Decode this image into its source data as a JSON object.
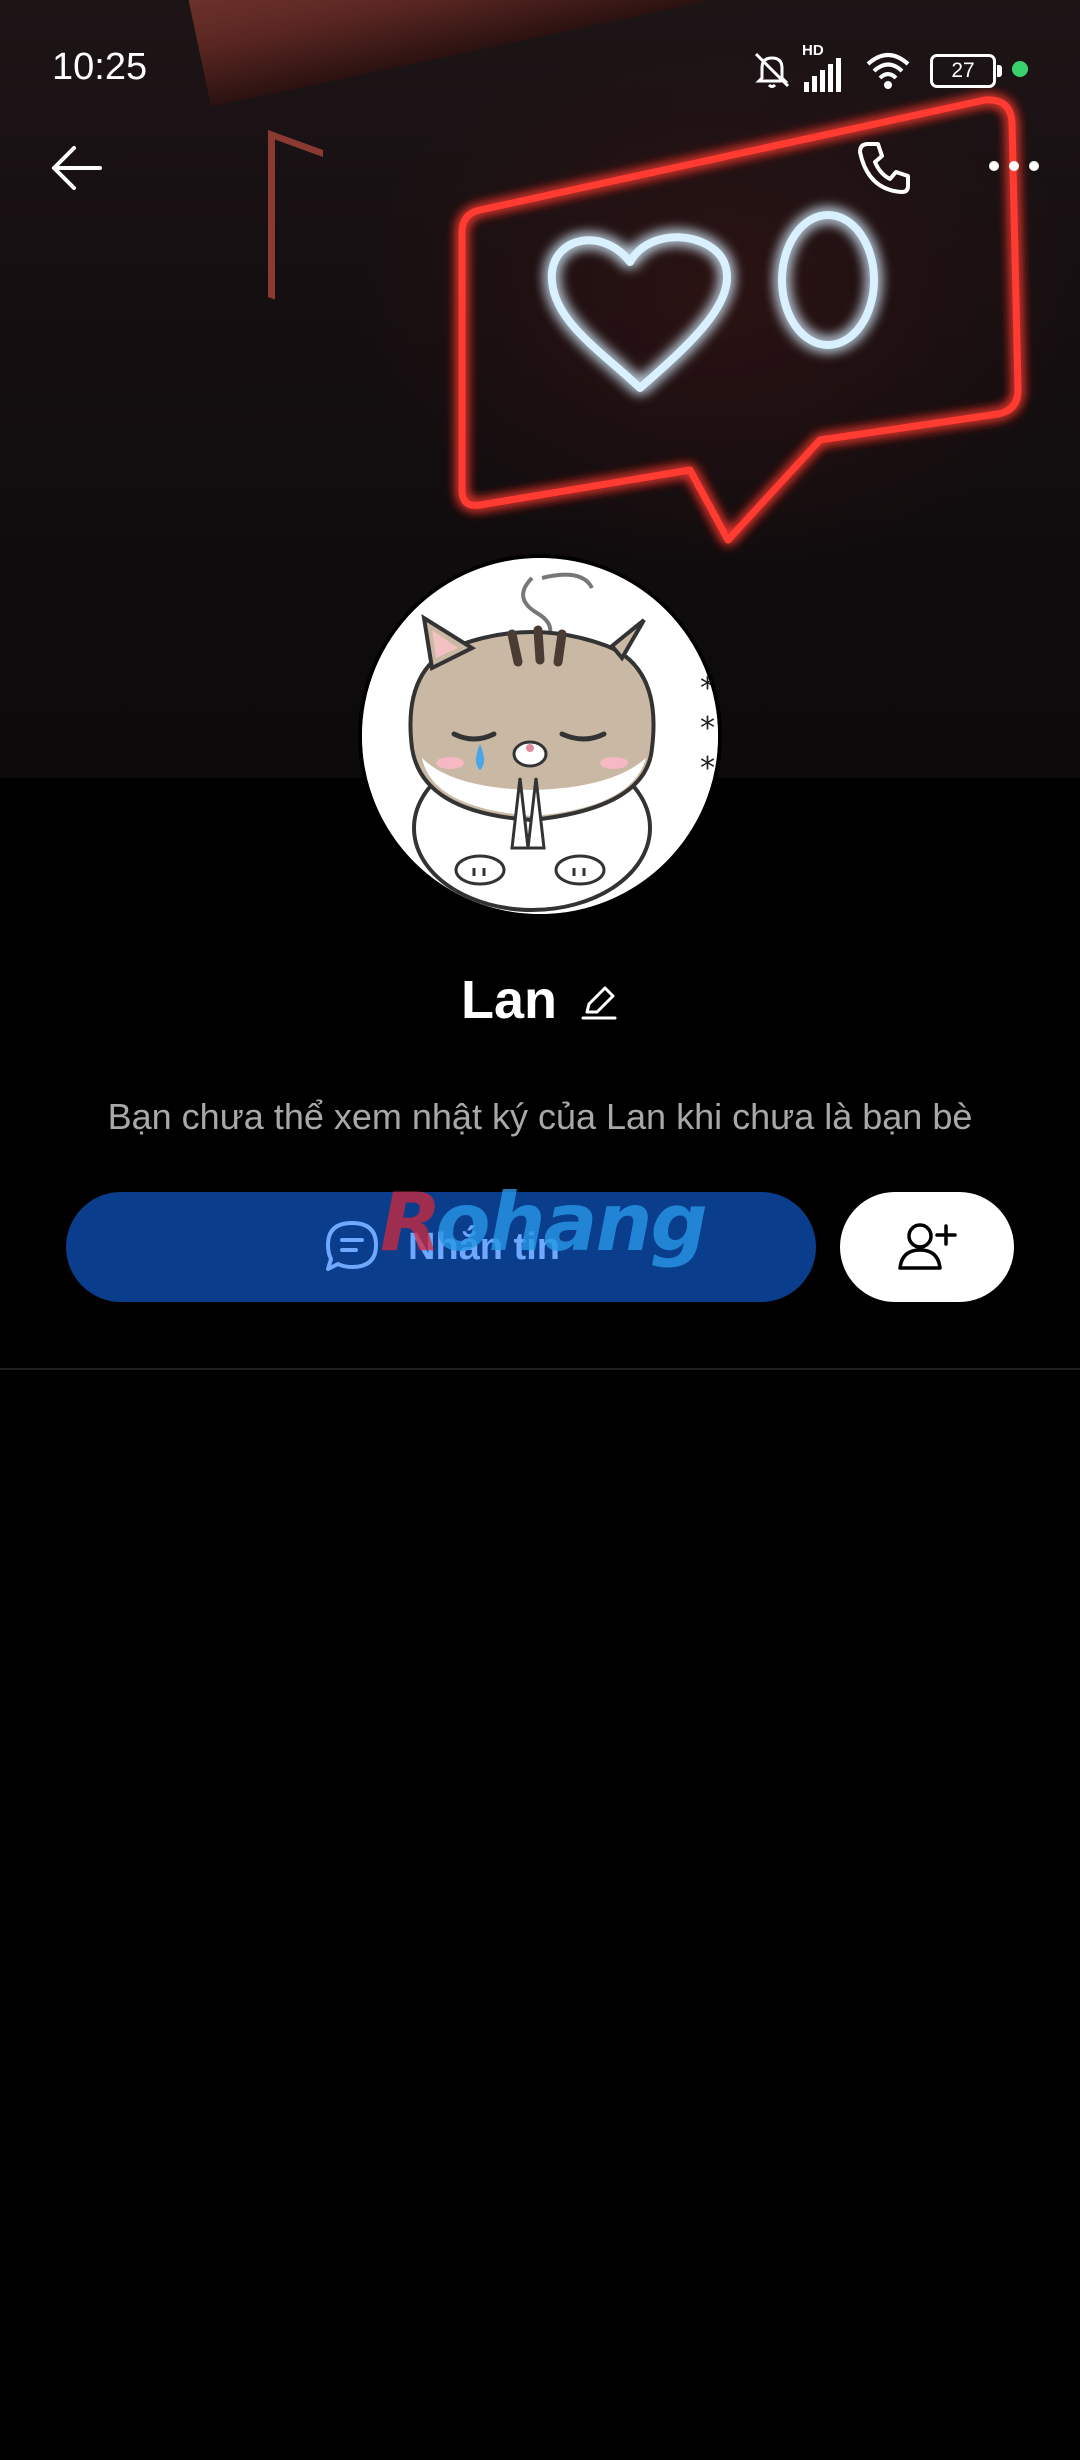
{
  "status_bar": {
    "time": "10:25",
    "network_badge": "HD",
    "battery_level": "27",
    "icons": [
      "mute-notifications-icon",
      "cellular-signal-icon",
      "wifi-icon",
      "battery-icon",
      "active-dot-icon"
    ]
  },
  "header": {
    "icons": [
      "back-arrow-icon",
      "phone-icon",
      "more-icon"
    ]
  },
  "cover": {
    "description_icons": [
      "neon-heart-icon",
      "neon-zero-icon",
      "neon-speech-bubble-icon"
    ]
  },
  "profile": {
    "name": "Lan",
    "avatar_icon": "cat-sticker-avatar",
    "edit_icon": "pencil-icon",
    "notice": "Bạn chưa thể xem nhật ký của Lan khi chưa là bạn bè"
  },
  "actions": {
    "message_label": "Nhắn tin",
    "message_icon": "chat-bubble-icon",
    "add_friend_icon": "add-friend-icon"
  },
  "watermark": {
    "first": "R",
    "rest": "ohang"
  },
  "colors": {
    "background": "#000000",
    "message_button": "#0a3d8c",
    "message_text": "#6fa8ff",
    "neon_red": "#ff3b30",
    "neon_blue": "#cfe9ff",
    "notice_text": "#a8a8a8"
  }
}
